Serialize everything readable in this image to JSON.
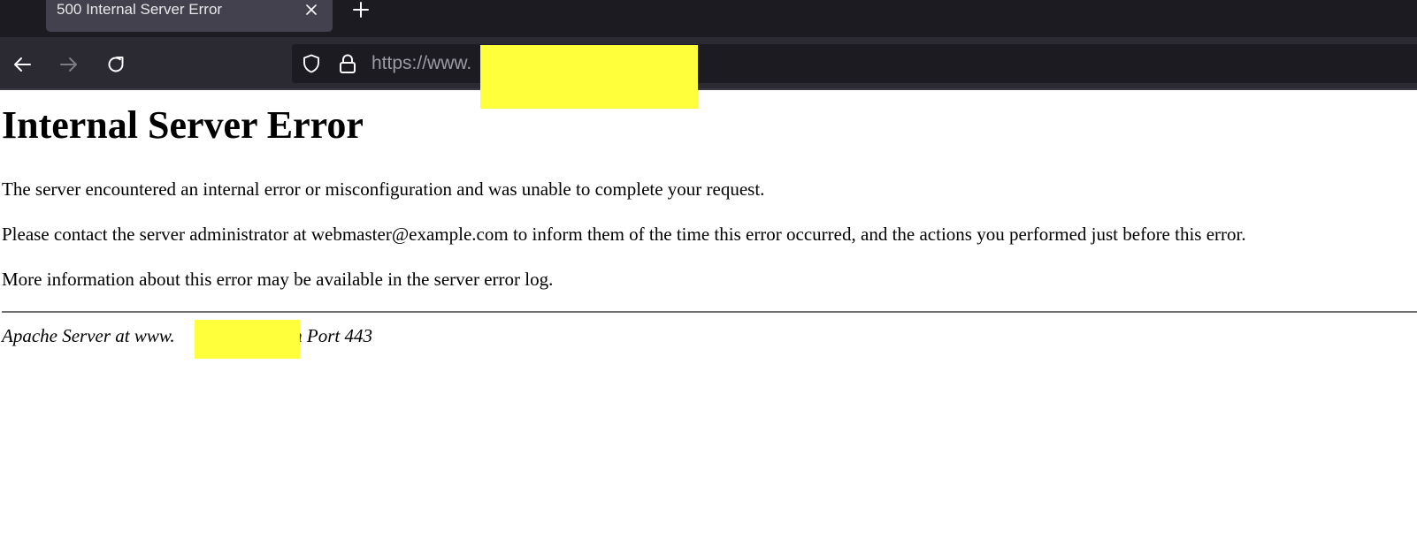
{
  "browser": {
    "tab": {
      "title": "500 Internal Server Error"
    },
    "urlbar": {
      "url_visible": "https://www."
    }
  },
  "page": {
    "title": "Internal Server Error",
    "paragraphs": [
      "The server encountered an internal error or misconfiguration and was unable to complete your request.",
      "Please contact the server administrator at webmaster@example.com to inform them of the time this error occurred, and the actions you performed just before this error.",
      "More information about this error may be available in the server error log."
    ],
    "address": {
      "prefix": "Apache Server at www.",
      "suffix": ".cn Port 443"
    }
  },
  "colors": {
    "tabstrip_bg": "#1c1b22",
    "tab_bg": "#42414d",
    "navbar_bg": "#2b2a33",
    "redaction": "#ffff3b"
  },
  "icons": {
    "tab_close": "close-icon",
    "new_tab": "plus-icon",
    "back": "arrow-left-icon",
    "forward": "arrow-right-icon",
    "reload": "reload-icon",
    "tracking_protection": "shield-icon",
    "secure": "lock-icon"
  }
}
